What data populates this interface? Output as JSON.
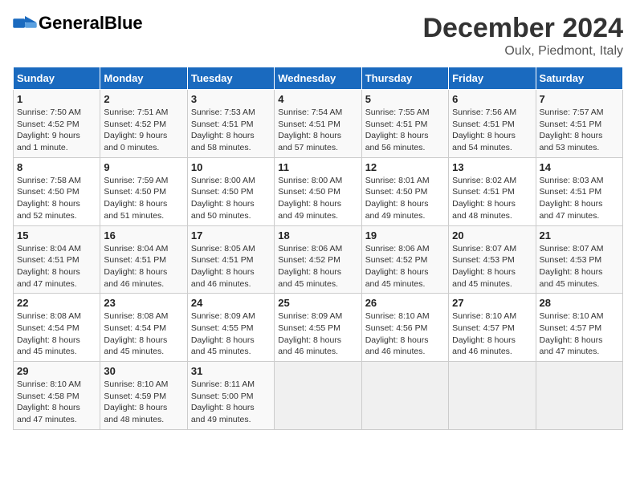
{
  "header": {
    "logo_general": "General",
    "logo_blue": "Blue",
    "title": "December 2024",
    "subtitle": "Oulx, Piedmont, Italy"
  },
  "weekdays": [
    "Sunday",
    "Monday",
    "Tuesday",
    "Wednesday",
    "Thursday",
    "Friday",
    "Saturday"
  ],
  "weeks": [
    [
      {
        "day": "1",
        "info": "Sunrise: 7:50 AM\nSunset: 4:52 PM\nDaylight: 9 hours\nand 1 minute."
      },
      {
        "day": "2",
        "info": "Sunrise: 7:51 AM\nSunset: 4:52 PM\nDaylight: 9 hours\nand 0 minutes."
      },
      {
        "day": "3",
        "info": "Sunrise: 7:53 AM\nSunset: 4:51 PM\nDaylight: 8 hours\nand 58 minutes."
      },
      {
        "day": "4",
        "info": "Sunrise: 7:54 AM\nSunset: 4:51 PM\nDaylight: 8 hours\nand 57 minutes."
      },
      {
        "day": "5",
        "info": "Sunrise: 7:55 AM\nSunset: 4:51 PM\nDaylight: 8 hours\nand 56 minutes."
      },
      {
        "day": "6",
        "info": "Sunrise: 7:56 AM\nSunset: 4:51 PM\nDaylight: 8 hours\nand 54 minutes."
      },
      {
        "day": "7",
        "info": "Sunrise: 7:57 AM\nSunset: 4:51 PM\nDaylight: 8 hours\nand 53 minutes."
      }
    ],
    [
      {
        "day": "8",
        "info": "Sunrise: 7:58 AM\nSunset: 4:50 PM\nDaylight: 8 hours\nand 52 minutes."
      },
      {
        "day": "9",
        "info": "Sunrise: 7:59 AM\nSunset: 4:50 PM\nDaylight: 8 hours\nand 51 minutes."
      },
      {
        "day": "10",
        "info": "Sunrise: 8:00 AM\nSunset: 4:50 PM\nDaylight: 8 hours\nand 50 minutes."
      },
      {
        "day": "11",
        "info": "Sunrise: 8:00 AM\nSunset: 4:50 PM\nDaylight: 8 hours\nand 49 minutes."
      },
      {
        "day": "12",
        "info": "Sunrise: 8:01 AM\nSunset: 4:50 PM\nDaylight: 8 hours\nand 49 minutes."
      },
      {
        "day": "13",
        "info": "Sunrise: 8:02 AM\nSunset: 4:51 PM\nDaylight: 8 hours\nand 48 minutes."
      },
      {
        "day": "14",
        "info": "Sunrise: 8:03 AM\nSunset: 4:51 PM\nDaylight: 8 hours\nand 47 minutes."
      }
    ],
    [
      {
        "day": "15",
        "info": "Sunrise: 8:04 AM\nSunset: 4:51 PM\nDaylight: 8 hours\nand 47 minutes."
      },
      {
        "day": "16",
        "info": "Sunrise: 8:04 AM\nSunset: 4:51 PM\nDaylight: 8 hours\nand 46 minutes."
      },
      {
        "day": "17",
        "info": "Sunrise: 8:05 AM\nSunset: 4:51 PM\nDaylight: 8 hours\nand 46 minutes."
      },
      {
        "day": "18",
        "info": "Sunrise: 8:06 AM\nSunset: 4:52 PM\nDaylight: 8 hours\nand 45 minutes."
      },
      {
        "day": "19",
        "info": "Sunrise: 8:06 AM\nSunset: 4:52 PM\nDaylight: 8 hours\nand 45 minutes."
      },
      {
        "day": "20",
        "info": "Sunrise: 8:07 AM\nSunset: 4:53 PM\nDaylight: 8 hours\nand 45 minutes."
      },
      {
        "day": "21",
        "info": "Sunrise: 8:07 AM\nSunset: 4:53 PM\nDaylight: 8 hours\nand 45 minutes."
      }
    ],
    [
      {
        "day": "22",
        "info": "Sunrise: 8:08 AM\nSunset: 4:54 PM\nDaylight: 8 hours\nand 45 minutes."
      },
      {
        "day": "23",
        "info": "Sunrise: 8:08 AM\nSunset: 4:54 PM\nDaylight: 8 hours\nand 45 minutes."
      },
      {
        "day": "24",
        "info": "Sunrise: 8:09 AM\nSunset: 4:55 PM\nDaylight: 8 hours\nand 45 minutes."
      },
      {
        "day": "25",
        "info": "Sunrise: 8:09 AM\nSunset: 4:55 PM\nDaylight: 8 hours\nand 46 minutes."
      },
      {
        "day": "26",
        "info": "Sunrise: 8:10 AM\nSunset: 4:56 PM\nDaylight: 8 hours\nand 46 minutes."
      },
      {
        "day": "27",
        "info": "Sunrise: 8:10 AM\nSunset: 4:57 PM\nDaylight: 8 hours\nand 46 minutes."
      },
      {
        "day": "28",
        "info": "Sunrise: 8:10 AM\nSunset: 4:57 PM\nDaylight: 8 hours\nand 47 minutes."
      }
    ],
    [
      {
        "day": "29",
        "info": "Sunrise: 8:10 AM\nSunset: 4:58 PM\nDaylight: 8 hours\nand 47 minutes."
      },
      {
        "day": "30",
        "info": "Sunrise: 8:10 AM\nSunset: 4:59 PM\nDaylight: 8 hours\nand 48 minutes."
      },
      {
        "day": "31",
        "info": "Sunrise: 8:11 AM\nSunset: 5:00 PM\nDaylight: 8 hours\nand 49 minutes."
      },
      {
        "day": "",
        "info": ""
      },
      {
        "day": "",
        "info": ""
      },
      {
        "day": "",
        "info": ""
      },
      {
        "day": "",
        "info": ""
      }
    ]
  ]
}
